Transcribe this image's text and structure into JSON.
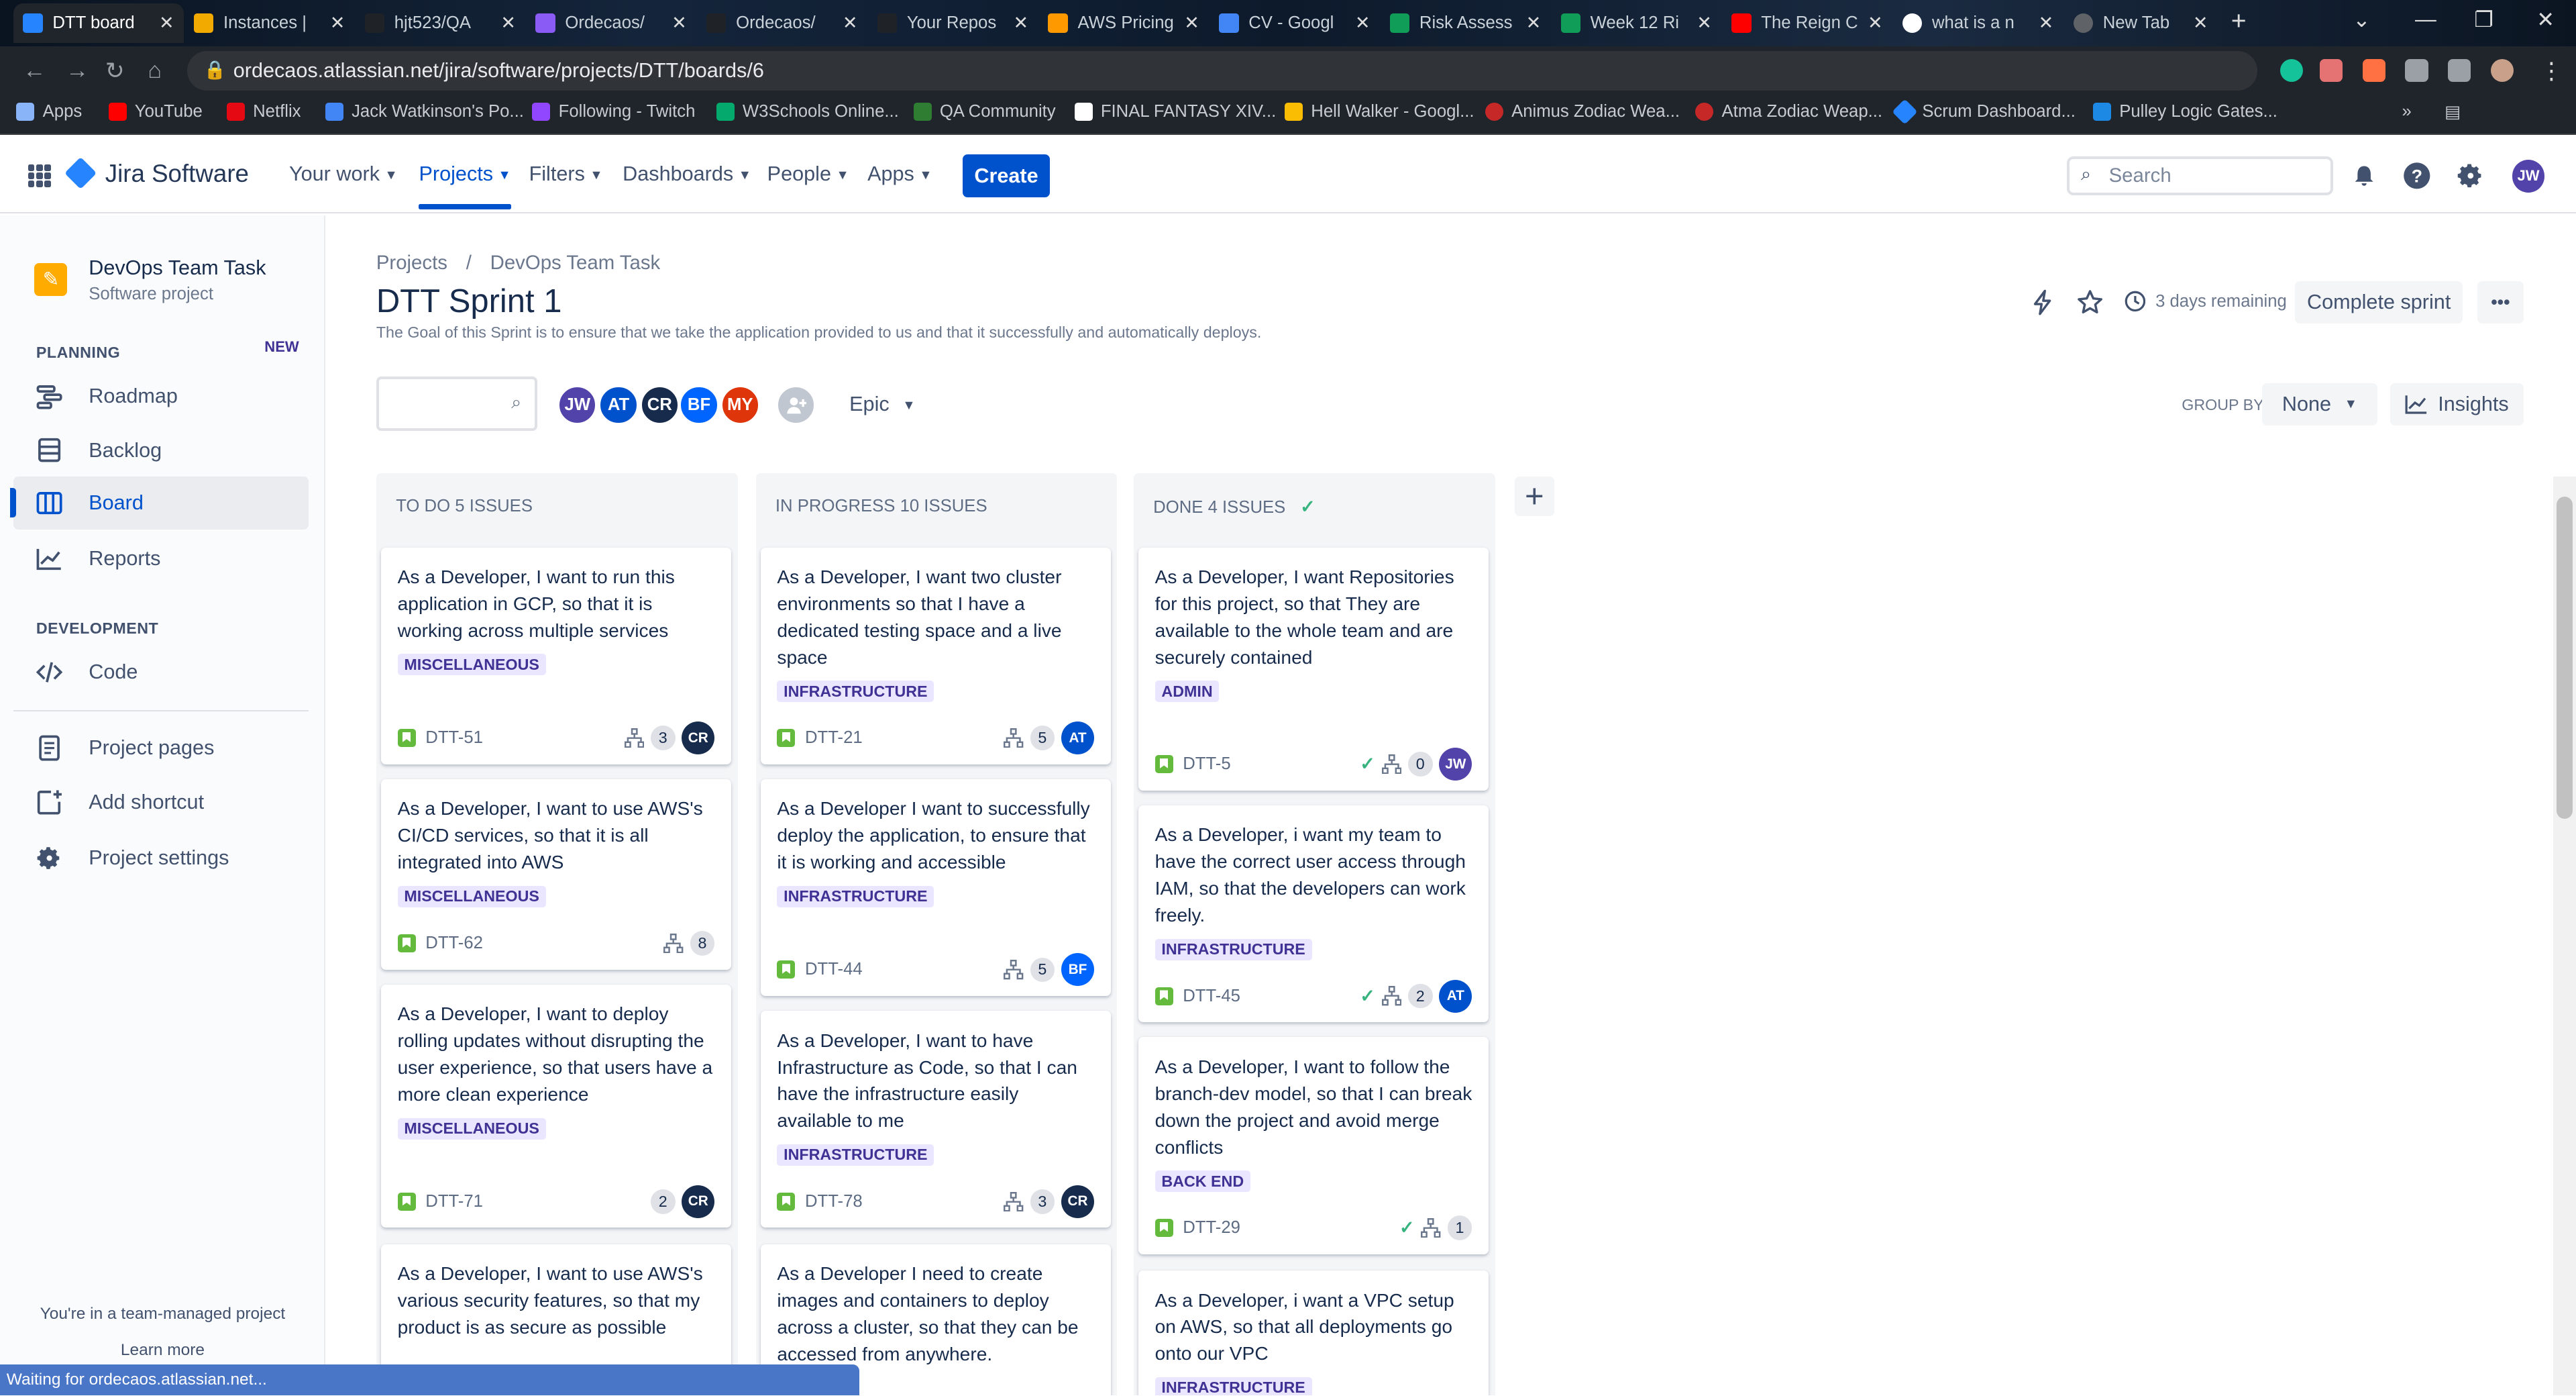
{
  "browser": {
    "tabs": [
      {
        "title": "DTT board",
        "color": "#2684ff"
      },
      {
        "title": "Instances |",
        "color": "#f2a900"
      },
      {
        "title": "hjt523/QA",
        "color": "#1f2328"
      },
      {
        "title": "Ordecaos/",
        "color": "#8a5cf5"
      },
      {
        "title": "Ordecaos/",
        "color": "#1f2328"
      },
      {
        "title": "Your Repos",
        "color": "#1f2328"
      },
      {
        "title": "AWS Pricing",
        "color": "#ff9900"
      },
      {
        "title": "CV - Googl",
        "color": "#4285f4"
      },
      {
        "title": "Risk Assess",
        "color": "#0f9d58"
      },
      {
        "title": "Week 12 Ri",
        "color": "#0f9d58"
      },
      {
        "title": "The Reign C",
        "color": "#ff0000"
      },
      {
        "title": "what is a n",
        "color": "#ffffff"
      },
      {
        "title": "New Tab",
        "color": "#5f6368"
      }
    ],
    "url": "ordecaos.atlassian.net/jira/software/projects/DTT/boards/6",
    "bookmarks": [
      {
        "label": "Apps",
        "color": "#8ab4f8"
      },
      {
        "label": "YouTube",
        "color": "#ff0000"
      },
      {
        "label": "Netflix",
        "color": "#e50914"
      },
      {
        "label": "Jack Watkinson's Po...",
        "color": "#4285f4"
      },
      {
        "label": "Following - Twitch",
        "color": "#9146ff"
      },
      {
        "label": "W3Schools Online...",
        "color": "#04aa6d"
      },
      {
        "label": "QA Community",
        "color": "#2e7d32"
      },
      {
        "label": "FINAL FANTASY XIV...",
        "color": "#ffffff"
      },
      {
        "label": "Hell Walker - Googl...",
        "color": "#fbbc04"
      },
      {
        "label": "Animus Zodiac Wea...",
        "color": "#c62828"
      },
      {
        "label": "Atma Zodiac Weap...",
        "color": "#c62828"
      },
      {
        "label": "Scrum Dashboard...",
        "color": "#2684ff"
      },
      {
        "label": "Pulley Logic Gates...",
        "color": "#1e88e5"
      }
    ],
    "status": "Waiting for ordecaos.atlassian.net..."
  },
  "nav": {
    "product": "Jira Software",
    "items": [
      "Your work",
      "Projects",
      "Filters",
      "Dashboards",
      "People",
      "Apps"
    ],
    "create": "Create",
    "search_placeholder": "Search",
    "user_initials": "JW"
  },
  "sidebar": {
    "project_name": "DevOps Team Task",
    "project_type": "Software project",
    "planning_label": "PLANNING",
    "new_badge": "NEW",
    "planning_items": [
      "Roadmap",
      "Backlog",
      "Board",
      "Reports"
    ],
    "development_label": "DEVELOPMENT",
    "development_items": [
      "Code"
    ],
    "other_items": [
      "Project pages",
      "Add shortcut",
      "Project settings"
    ],
    "footer": "You're in a team-managed project",
    "learn_more": "Learn more"
  },
  "main": {
    "breadcrumb": [
      "Projects",
      "/",
      "DevOps Team Task"
    ],
    "title": "DTT Sprint 1",
    "goal": "The Goal of this Sprint is to ensure that we take the application provided to us and that it successfully and automatically deploys.",
    "remaining": "3 days remaining",
    "complete_sprint": "Complete sprint",
    "more": "•••",
    "epic_filter": "Epic",
    "group_by_label": "GROUP BY",
    "group_by_value": "None",
    "insights": "Insights",
    "avatars": [
      {
        "initials": "JW",
        "color": "#5243aa"
      },
      {
        "initials": "AT",
        "color": "#0052cc"
      },
      {
        "initials": "CR",
        "color": "#172b4d"
      },
      {
        "initials": "BF",
        "color": "#0065ff"
      },
      {
        "initials": "MY",
        "color": "#de350b"
      }
    ]
  },
  "columns": [
    {
      "header": "TO DO 5 ISSUES",
      "cards": [
        {
          "text": "As a Developer, I want to run this application in GCP, so that it is working across multiple services",
          "label": "MISCELLANEOUS",
          "key": "DTT-51",
          "points": "3",
          "assignee": "CR",
          "subtasks": true
        },
        {
          "text": "As a Developer, I want to use AWS's CI/CD services, so that it is all integrated into AWS",
          "label": "MISCELLANEOUS",
          "key": "DTT-62",
          "points": "8",
          "assignee": "",
          "subtasks": true
        },
        {
          "text": "As a Developer, I want to deploy rolling updates without disrupting the user experience, so that users have a more clean experience",
          "label": "MISCELLANEOUS",
          "key": "DTT-71",
          "points": "2",
          "assignee": "CR",
          "subtasks": false
        },
        {
          "text": "As a Developer, I want to use AWS's various security features, so that my product is as secure as possible",
          "label": "",
          "key": "",
          "points": "",
          "assignee": "",
          "subtasks": false
        }
      ]
    },
    {
      "header": "IN PROGRESS 10 ISSUES",
      "cards": [
        {
          "text": "As a Developer, I want two cluster environments so that I have a dedicated testing space and a live space",
          "label": "INFRASTRUCTURE",
          "key": "DTT-21",
          "points": "5",
          "assignee": "AT",
          "subtasks": true
        },
        {
          "text": "As a Developer I want to successfully deploy the application, to ensure that it is working and accessible",
          "label": "INFRASTRUCTURE",
          "key": "DTT-44",
          "points": "5",
          "assignee": "BF",
          "subtasks": true
        },
        {
          "text": "As a Developer, I want to have Infrastructure as Code, so that I can have the infrastructure easily available to me",
          "label": "INFRASTRUCTURE",
          "key": "DTT-78",
          "points": "3",
          "assignee": "CR",
          "subtasks": true
        },
        {
          "text": "As a Developer I need to create images and containers to deploy across a cluster, so that they can be accessed from anywhere.",
          "label": "",
          "key": "",
          "points": "",
          "assignee": "",
          "subtasks": false
        }
      ]
    },
    {
      "header": "DONE 4 ISSUES",
      "cards": [
        {
          "text": "As a Developer, I want Repositories for this project, so that They are available to the whole team and are securely contained",
          "label": "ADMIN",
          "key": "DTT-5",
          "points": "0",
          "assignee": "JW",
          "subtasks": true
        },
        {
          "text": "As a Developer, i want my team to have the correct user access through IAM, so that the developers can work freely.",
          "label": "INFRASTRUCTURE",
          "key": "DTT-45",
          "points": "2",
          "assignee": "AT",
          "subtasks": true
        },
        {
          "text": "As a Developer, I want to follow the branch-dev model, so that I can break down the project and avoid merge conflicts",
          "label": "BACK END",
          "key": "DTT-29",
          "points": "1",
          "assignee": "",
          "subtasks": true
        },
        {
          "text": "As a Developer, i want a VPC setup on AWS, so that all deployments go onto our VPC",
          "label": "INFRASTRUCTURE",
          "key": "",
          "points": "",
          "assignee": "",
          "subtasks": false
        }
      ]
    }
  ]
}
